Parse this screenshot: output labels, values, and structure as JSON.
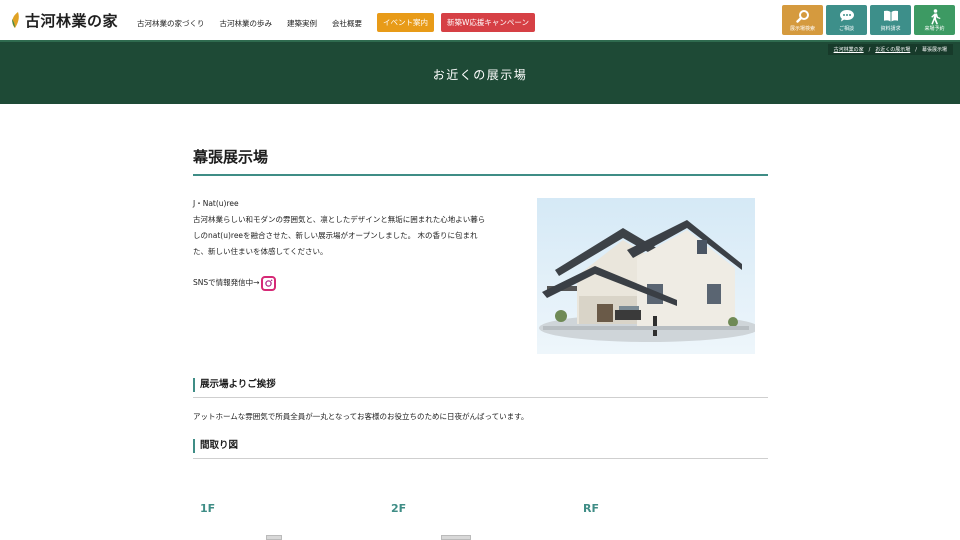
{
  "header": {
    "logo_text": "古河林業の家",
    "nav": [
      "古河林業の家づくり",
      "古河林業の歩み",
      "建築実例",
      "会社概要"
    ],
    "event_button": "イベント案内",
    "campaign_button": "新築W応援キャンペーン",
    "quick_links": [
      {
        "label": "展示場検索",
        "icon": "search-icon",
        "color": "#d59a3e"
      },
      {
        "label": "ご相談",
        "icon": "chat-icon",
        "color": "#3d8f8a"
      },
      {
        "label": "資料請求",
        "icon": "book-icon",
        "color": "#3d8f8a"
      },
      {
        "label": "来場予約",
        "icon": "walking-person-icon",
        "color": "#3d9a63"
      }
    ]
  },
  "band": {
    "title": "お近くの展示場",
    "breadcrumb": [
      "古河林業の家",
      "お近くの展示場",
      "幕張展示場"
    ]
  },
  "main": {
    "title": "幕張展示場",
    "desc_lines": [
      "J・Nat(u)ree",
      "古河林業らしい和モダンの雰囲気と、凛としたデザインと無垢に囲まれた心地よい暮ら",
      "しのnat(u)reeを融合させた、新しい展示場がオープンしました。 木の香りに包まれ",
      "た、新しい住まいを体感してください。"
    ],
    "sns_text": "SNSで情報発信中→",
    "greeting_heading": "展示場よりご挨拶",
    "greeting_text": "アットホームな雰囲気で所員全員が一丸となってお客様のお役立ちのために日夜がんばっています。",
    "floorplan_heading": "間取り図",
    "floors": [
      "1F",
      "2F",
      "RF"
    ]
  },
  "colors": {
    "accent": "#3f8d86",
    "band": "#1e4a36",
    "event": "#e89b18",
    "campaign": "#d64045"
  }
}
